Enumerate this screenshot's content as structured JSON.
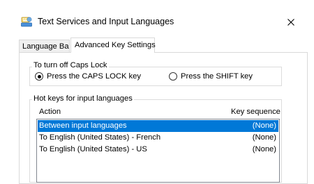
{
  "window": {
    "title": "Text Services and Input Languages"
  },
  "tabs": [
    {
      "label": "Language Bar",
      "active": false
    },
    {
      "label": "Advanced Key Settings",
      "active": true
    }
  ],
  "caps_lock_group": {
    "label": "To turn off Caps Lock",
    "options": [
      {
        "label": "Press the CAPS LOCK key",
        "selected": true
      },
      {
        "label": "Press the SHIFT key",
        "selected": false
      }
    ]
  },
  "hot_keys_group": {
    "label": "Hot keys for input languages",
    "columns": {
      "action": "Action",
      "key_sequence": "Key sequence"
    },
    "rows": [
      {
        "action": "Between input languages",
        "key_sequence": "(None)",
        "selected": true
      },
      {
        "action": "To English (United States) - French",
        "key_sequence": "(None)",
        "selected": false
      },
      {
        "action": "To English (United States) - US",
        "key_sequence": "(None)",
        "selected": false
      }
    ]
  },
  "colors": {
    "selection_background": "#0078d7",
    "selection_text": "#ffffff"
  },
  "icons": {
    "title": "keyboard-globe-icon",
    "close": "close-icon"
  }
}
